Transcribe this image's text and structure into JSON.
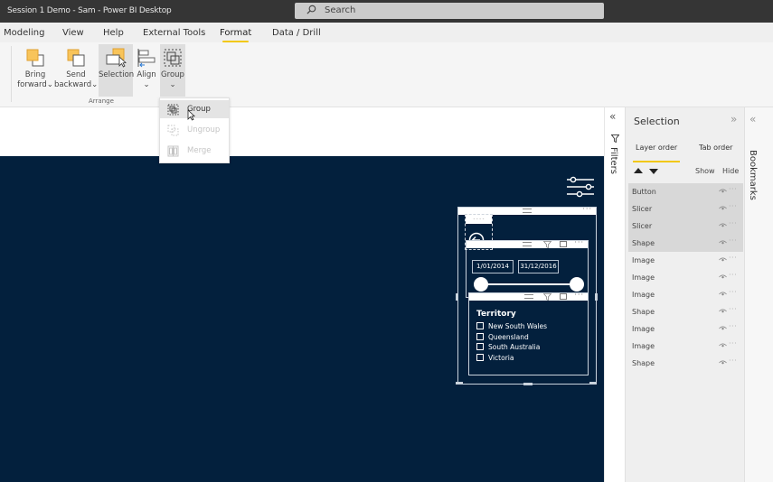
{
  "window": {
    "title": "Session 1 Demo - Sam - Power BI Desktop"
  },
  "search": {
    "label": "Search",
    "icon": "search-icon"
  },
  "menu": {
    "tabs": [
      {
        "label": "Modeling",
        "active": false
      },
      {
        "label": "View",
        "active": false
      },
      {
        "label": "Help",
        "active": false
      },
      {
        "label": "External Tools",
        "active": false
      },
      {
        "label": "Format",
        "active": true
      },
      {
        "label": "Data / Drill",
        "active": false
      }
    ]
  },
  "ribbon": {
    "group_label": "Arrange",
    "buttons": [
      {
        "line1": "Bring",
        "line2": "forward",
        "icon": "bring-forward-icon",
        "dropdown": true
      },
      {
        "line1": "Send",
        "line2": "backward",
        "icon": "send-backward-icon",
        "dropdown": true
      },
      {
        "line1": "Selection",
        "line2": "",
        "icon": "selection-icon",
        "dropdown": false
      },
      {
        "line1": "Align",
        "line2": "",
        "icon": "align-icon",
        "dropdown": true
      },
      {
        "line1": "Group",
        "line2": "",
        "icon": "group-icon",
        "dropdown": true
      }
    ]
  },
  "group_dropdown": {
    "items": [
      {
        "label": "Group",
        "enabled": true,
        "icon": "group-icon"
      },
      {
        "label": "Ungroup",
        "enabled": false,
        "icon": "ungroup-icon"
      },
      {
        "label": "Merge",
        "enabled": false,
        "icon": "merge-icon"
      }
    ]
  },
  "canvas": {
    "background_color": "#03203d",
    "date_slicer": {
      "start": "1/01/2014",
      "end": "31/12/2016"
    },
    "territory_slicer": {
      "title": "Territory",
      "items": [
        "New South Wales",
        "Queensland",
        "South Australia",
        "Victoria"
      ]
    },
    "button_label": "- - - -"
  },
  "filters_pane": {
    "label": "Filters"
  },
  "selection_pane": {
    "title": "Selection",
    "tabs": [
      {
        "label": "Layer order",
        "active": true
      },
      {
        "label": "Tab order",
        "active": false
      }
    ],
    "show_label": "Show",
    "hide_label": "Hide",
    "layers": [
      {
        "name": "Button",
        "selected": true
      },
      {
        "name": "Slicer",
        "selected": true
      },
      {
        "name": "Slicer",
        "selected": true
      },
      {
        "name": "Shape",
        "selected": true
      },
      {
        "name": "Image",
        "selected": false
      },
      {
        "name": "Image",
        "selected": false
      },
      {
        "name": "Image",
        "selected": false
      },
      {
        "name": "Shape",
        "selected": false
      },
      {
        "name": "Image",
        "selected": false
      },
      {
        "name": "Image",
        "selected": false
      },
      {
        "name": "Shape",
        "selected": false
      }
    ]
  },
  "bookmarks_pane": {
    "label": "Bookmarks"
  },
  "colors": {
    "accent": "#f2c811",
    "canvas": "#03203d"
  }
}
